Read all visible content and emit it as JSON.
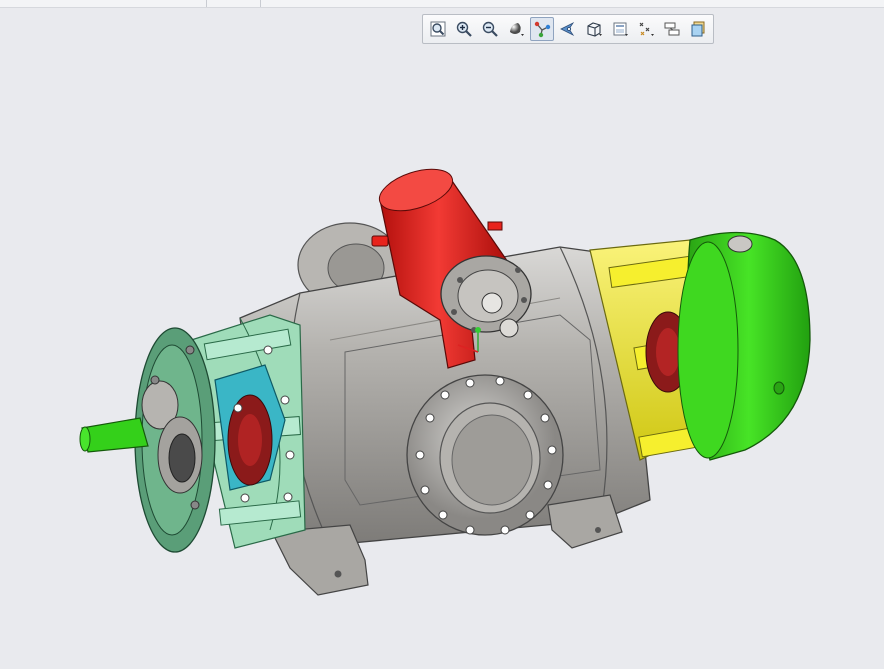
{
  "toolbar": {
    "buttons": [
      {
        "icon": "zoom-to-fit-icon"
      },
      {
        "icon": "zoom-in-icon"
      },
      {
        "icon": "zoom-out-icon"
      },
      {
        "icon": "shading-style-icon"
      },
      {
        "icon": "datum-display-icon",
        "active": true
      },
      {
        "icon": "spin-center-icon"
      },
      {
        "icon": "view-orientation-icon"
      },
      {
        "icon": "saved-views-icon"
      },
      {
        "icon": "datum-points-icon"
      },
      {
        "icon": "annotation-display-icon"
      },
      {
        "icon": "appearance-icon"
      }
    ]
  },
  "model": {
    "colors": {
      "housing": "#a9a7a3",
      "motor": "#e5201c",
      "left_bracket": "#9fdcb9",
      "left_cover": "#5a9e78",
      "right_frame": "#f1ea1a",
      "right_cover": "#3bd11b",
      "coupling": "#3ab6c6",
      "seal": "#8b1a1a",
      "shaft": "#34d01a",
      "background": "#e9eaee"
    }
  }
}
